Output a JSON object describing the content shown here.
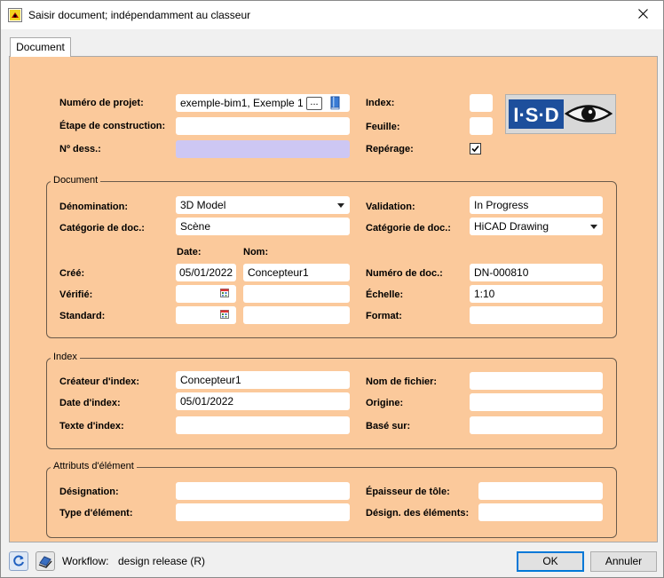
{
  "window": {
    "title": "Saisir document; indépendamment au classeur",
    "app_icon": "hicad-app-icon",
    "close_icon": "close-icon"
  },
  "tab": {
    "label": "Document"
  },
  "header": {
    "project_number_label": "Numéro de projet:",
    "project_number_value": "exemple-bim1, Exemple 1",
    "browse_label": "...",
    "construction_stage_label": "Étape de construction:",
    "construction_stage_value": "",
    "drawing_number_label": "Nº dess.:",
    "drawing_number_value": "",
    "index_label": "Index:",
    "index_value": "",
    "sheet_label": "Feuille:",
    "sheet_value": "",
    "marking_label": "Repérage:",
    "marking_checked": true
  },
  "logo": {
    "text": "I·S·D"
  },
  "document_group": {
    "title": "Document",
    "denomination_label": "Dénomination:",
    "denomination_value": "3D Model",
    "validation_label": "Validation:",
    "validation_value": "In Progress",
    "doc_category_label": "Catégorie de doc.:",
    "doc_category_value": "Scène",
    "doc_category2_label": "Catégorie de doc.:",
    "doc_category2_value": "HiCAD Drawing",
    "date_header": "Date:",
    "name_header": "Nom:",
    "created_label": "Créé:",
    "created_date": "05/01/2022",
    "created_name": "Concepteur1",
    "doc_number_label": "Numéro de doc.:",
    "doc_number_value": "DN-000810",
    "verified_label": "Vérifié:",
    "verified_date": "",
    "verified_name": "",
    "scale_label": "Échelle:",
    "scale_value": "1:10",
    "standard_label": "Standard:",
    "standard_date": "",
    "standard_name": "",
    "format_label": "Format:",
    "format_value": ""
  },
  "index_group": {
    "title": "Index",
    "creator_label": "Créateur d'index:",
    "creator_value": "Concepteur1",
    "filename_label": "Nom de fichier:",
    "filename_value": "",
    "date_label": "Date d'index:",
    "date_value": "05/01/2022",
    "origin_label": "Origine:",
    "origin_value": "",
    "text_label": "Texte d'index:",
    "text_value": "",
    "based_on_label": "Basé sur:",
    "based_on_value": ""
  },
  "element_group": {
    "title": "Attributs d'élément",
    "designation_label": "Désignation:",
    "designation_value": "",
    "sheet_thickness_label": "Épaisseur de tôle:",
    "sheet_thickness_value": "",
    "element_type_label": "Type d'élément:",
    "element_type_value": "",
    "element_designation_label": "Désign. des éléments:",
    "element_designation_value": ""
  },
  "footer": {
    "refresh_icon": "refresh-icon",
    "stamp_icon": "stamp-icon",
    "workflow_label": "Workflow:",
    "workflow_value": "design release (R)",
    "ok_label": "OK",
    "cancel_label": "Annuler"
  },
  "colors": {
    "panel_bg": "#fbc99b",
    "lilac_field": "#cdc7f3",
    "logo_blue": "#1d4f9c"
  }
}
